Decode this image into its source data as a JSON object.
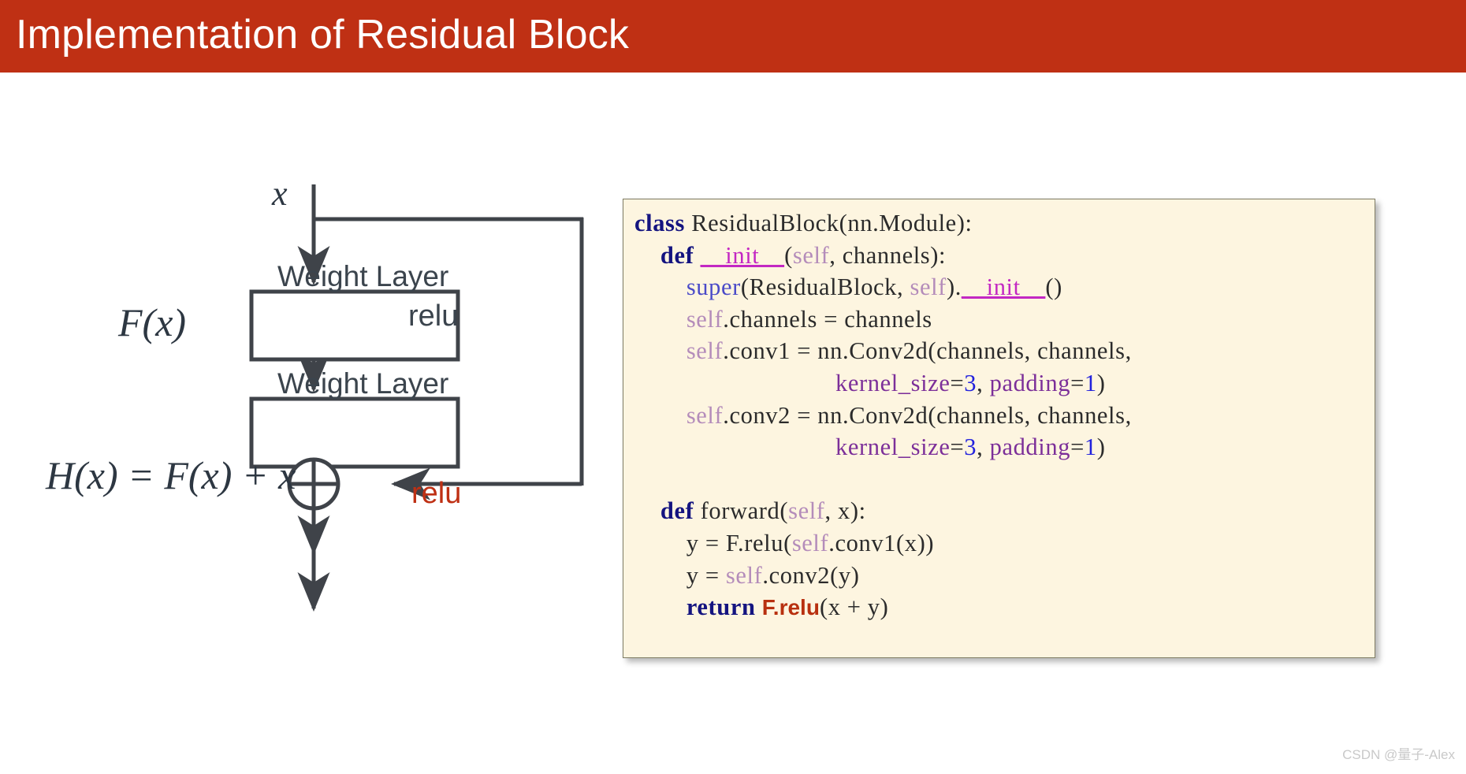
{
  "slide": {
    "title": "Implementation of Residual Block",
    "title_bar_color": "#bf3014",
    "background_color": "#ffffff"
  },
  "diagram": {
    "input_label": "x",
    "function_label": "F(x)",
    "output_label": "H(x) = F(x) + x",
    "relu_mid_label": "relu",
    "relu_out_label": "relu",
    "relu_out_color": "#bf3014",
    "box1_label": "Weight Layer",
    "box2_label": "Weight Layer",
    "sum_node_symbol": "plus-circle",
    "line_color": "#3f4349",
    "box_border_color": "#3f4349",
    "box_fill_color": "#ffffff"
  },
  "code": {
    "language": "python",
    "background_color": "#fdf5e0",
    "border_color": "#7d7a62",
    "lines": [
      "class ResidualBlock(nn.Module):",
      "    def __init__(self, channels):",
      "        super(ResidualBlock, self).__init__()",
      "        self.channels = channels",
      "        self.conv1 = nn.Conv2d(channels, channels,",
      "                               kernel_size=3, padding=1)",
      "        self.conv2 = nn.Conv2d(channels, channels,",
      "                               kernel_size=3, padding=1)",
      "",
      "    def forward(self, x):",
      "        y = F.relu(self.conv1(x))",
      "        y = self.conv2(y)",
      "        return F.relu(x + y)"
    ],
    "syntax_colors": {
      "keyword": "#141480",
      "dunder": "#c328c3",
      "self": "#b48cba",
      "super": "#4a4ac8",
      "kwarg": "#7c2f99",
      "number": "#2222dd",
      "highlight_frelu": "#b8300f",
      "plain": "#2b2b2b"
    }
  },
  "watermark": {
    "text": "CSDN @量子-Alex"
  }
}
